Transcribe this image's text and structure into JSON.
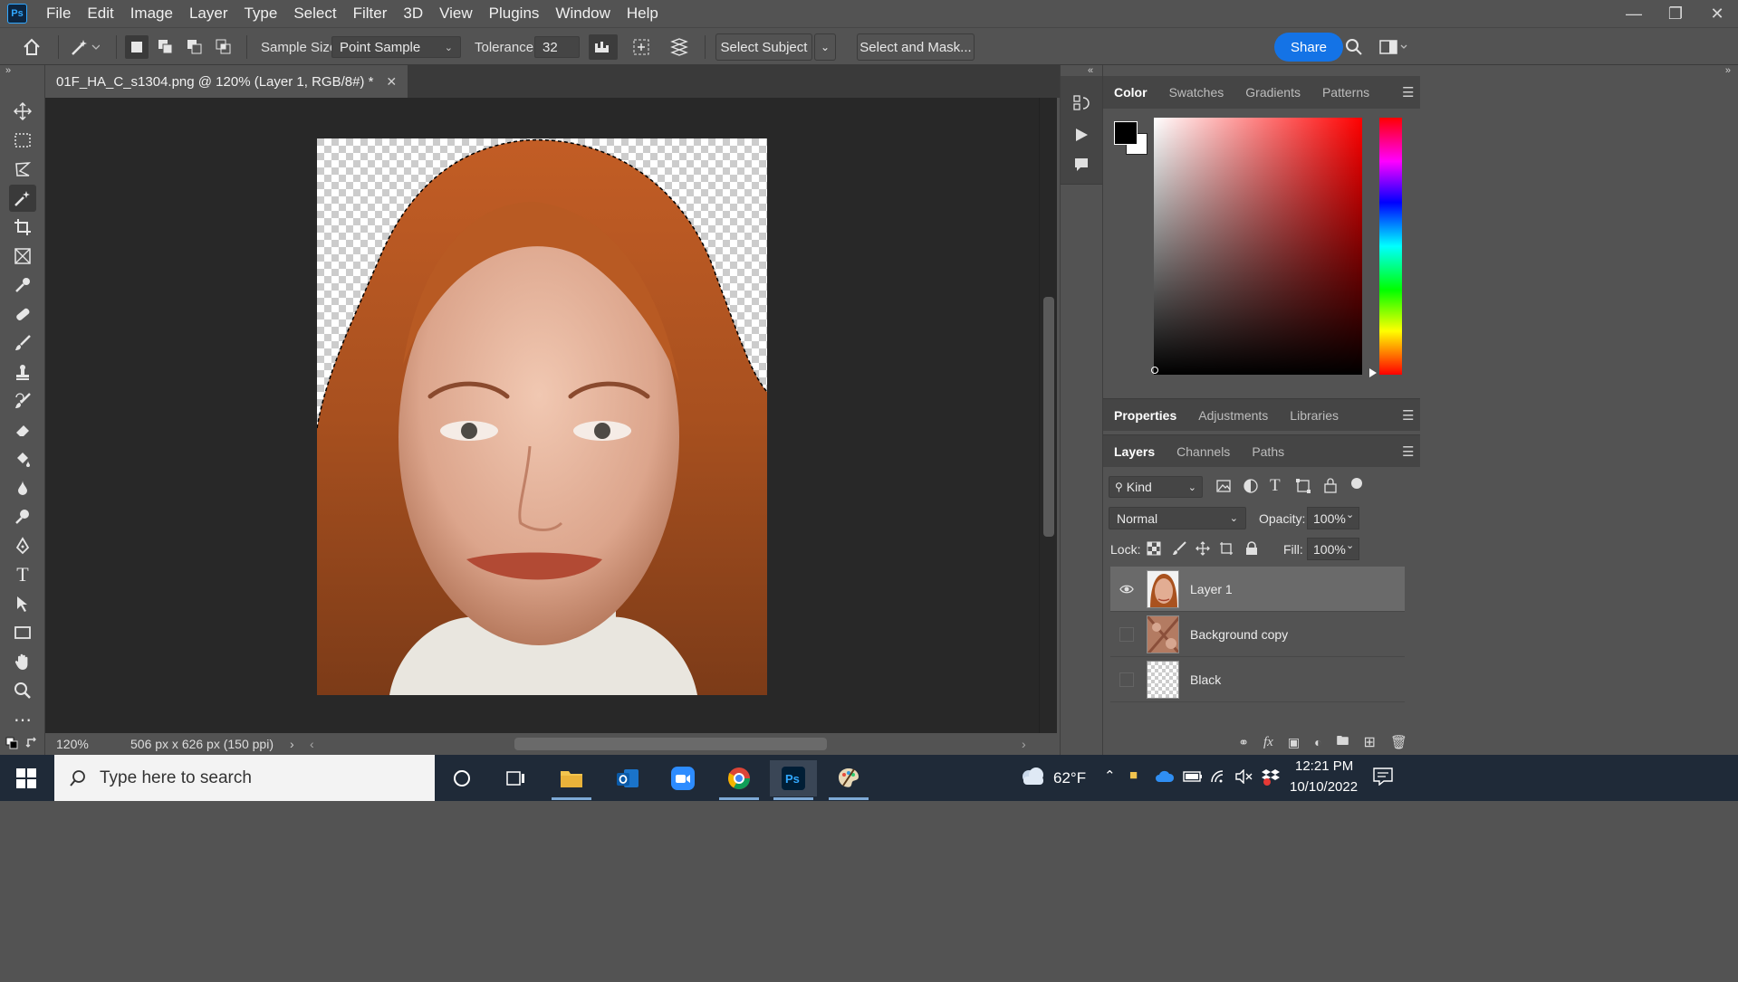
{
  "app": {
    "logo": "Ps"
  },
  "menu": [
    "File",
    "Edit",
    "Image",
    "Layer",
    "Type",
    "Select",
    "Filter",
    "3D",
    "View",
    "Plugins",
    "Window",
    "Help"
  ],
  "options": {
    "sample_size_label": "Sample Size:",
    "sample_size_value": "Point Sample",
    "tolerance_label": "Tolerance:",
    "tolerance_value": "32",
    "select_subject": "Select Subject",
    "select_and_mask": "Select and Mask...",
    "share": "Share"
  },
  "document": {
    "tab_title": "01F_HA_C_s1304.png @ 120% (Layer 1, RGB/8#) *",
    "zoom": "120%",
    "info": "506 px x 626 px (150 ppi)"
  },
  "panels": {
    "color_tabs": [
      "Color",
      "Swatches",
      "Gradients",
      "Patterns"
    ],
    "props_tabs": [
      "Properties",
      "Adjustments",
      "Libraries"
    ],
    "layer_tabs": [
      "Layers",
      "Channels",
      "Paths"
    ],
    "kind_filter": "Kind",
    "blend_mode": "Normal",
    "opacity_label": "Opacity:",
    "opacity_value": "100%",
    "lock_label": "Lock:",
    "fill_label": "Fill:",
    "fill_value": "100%"
  },
  "layers": [
    {
      "name": "Layer 1",
      "visible": true,
      "selected": true
    },
    {
      "name": "Background copy",
      "visible": false,
      "selected": false
    },
    {
      "name": "Black",
      "visible": false,
      "selected": false
    }
  ],
  "taskbar": {
    "search_placeholder": "Type here to search",
    "weather": "62°F",
    "time": "12:21 PM",
    "date": "10/10/2022"
  }
}
